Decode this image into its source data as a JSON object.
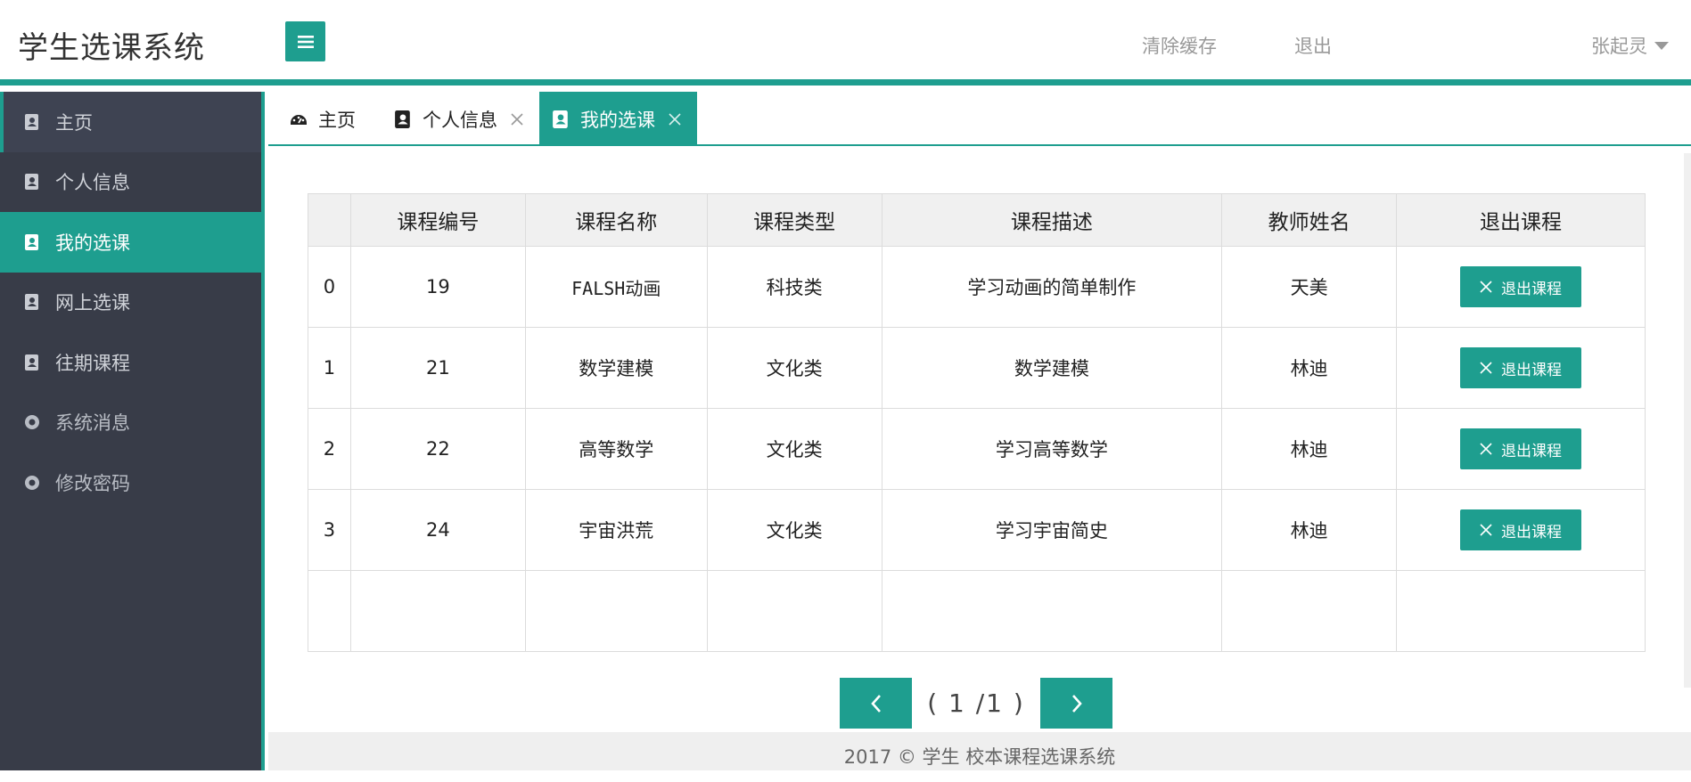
{
  "header": {
    "title": "学生选课系统",
    "clear_cache": "清除缓存",
    "logout": "退出",
    "username": "张起灵"
  },
  "sidebar": {
    "items": [
      {
        "label": "主页",
        "icon": "contact-book-icon"
      },
      {
        "label": "个人信息",
        "icon": "contact-book-icon"
      },
      {
        "label": "我的选课",
        "icon": "contact-book-icon"
      },
      {
        "label": "网上选课",
        "icon": "contact-book-icon"
      },
      {
        "label": "往期课程",
        "icon": "contact-book-icon"
      },
      {
        "label": "系统消息",
        "icon": "circle-icon"
      },
      {
        "label": "修改密码",
        "icon": "circle-icon"
      }
    ]
  },
  "tabs": [
    {
      "label": "主页",
      "icon": "dashboard-icon"
    },
    {
      "label": "个人信息",
      "icon": "contact-book-icon"
    },
    {
      "label": "我的选课",
      "icon": "contact-book-icon"
    }
  ],
  "table": {
    "headers": [
      "",
      "课程编号",
      "课程名称",
      "课程类型",
      "课程描述",
      "教师姓名",
      "退出课程"
    ],
    "quit_label": "退出课程",
    "rows": [
      {
        "idx": "0",
        "id": "19",
        "name": "FALSH动画",
        "type": "科技类",
        "desc": "学习动画的简单制作",
        "teacher": "天美"
      },
      {
        "idx": "1",
        "id": "21",
        "name": "数学建模",
        "type": "文化类",
        "desc": "数学建模",
        "teacher": "林迪"
      },
      {
        "idx": "2",
        "id": "22",
        "name": "高等数学",
        "type": "文化类",
        "desc": "学习高等数学",
        "teacher": "林迪"
      },
      {
        "idx": "3",
        "id": "24",
        "name": "宇宙洪荒",
        "type": "文化类",
        "desc": "学习宇宙简史",
        "teacher": "林迪"
      }
    ]
  },
  "pager": {
    "text": "( 1 /1 )"
  },
  "footer": {
    "text": "2017 ©  学生  校本课程选课系统"
  },
  "colors": {
    "accent": "#1e9e8f",
    "sidebar_bg": "#383c48"
  }
}
